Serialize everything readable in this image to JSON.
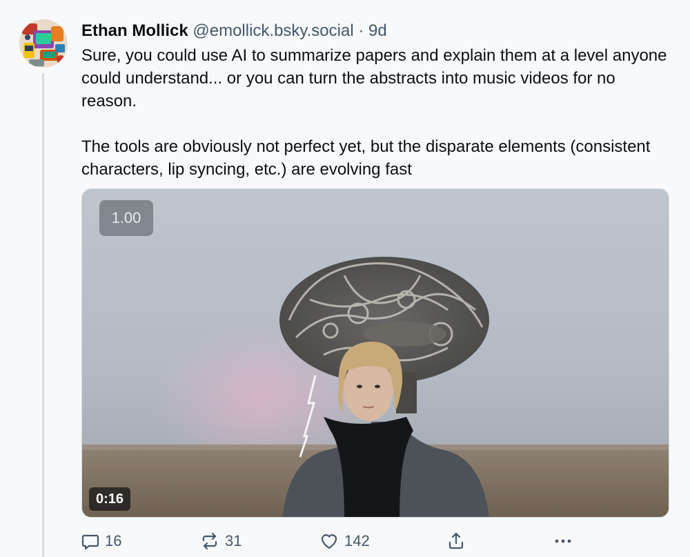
{
  "post": {
    "author": {
      "display_name": "Ethan Mollick",
      "handle": "@emollick.bsky.social",
      "separator": "·",
      "time_ago": "9d",
      "avatar_icon": "retro-devices-illustration-avatar"
    },
    "text": {
      "paragraph_1": "Sure, you could use AI to summarize papers and explain them at a level anyone could understand... or you can turn the abstracts into music videos for no reason.",
      "paragraph_2": "The tools are obviously not perfect yet, but the disparate elements (consistent characters, lip syncing, etc.) are evolving fast"
    },
    "video": {
      "playback_speed": "1.00",
      "duration": "0:16"
    },
    "actions": {
      "reply_count": "16",
      "repost_count": "31",
      "like_count": "142",
      "share_icon": "share-icon",
      "more_icon": "more-options-icon"
    }
  },
  "colors": {
    "background": "#f8f9fa",
    "text": "#0b0f14",
    "muted": "#42576c",
    "thread_line": "#d4dbe3"
  }
}
